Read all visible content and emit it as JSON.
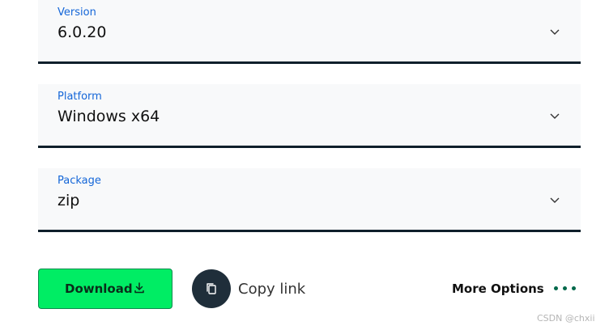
{
  "selects": [
    {
      "label": "Version",
      "value": "6.0.20",
      "icon": "chevron-down-icon"
    },
    {
      "label": "Platform",
      "value": "Windows x64",
      "icon": "chevron-down-icon"
    },
    {
      "label": "Package",
      "value": "zip",
      "icon": "chevron-down-icon"
    }
  ],
  "actions": {
    "download_label": "Download",
    "download_icon": "download-icon",
    "copy_link_label": "Copy link",
    "copy_icon": "copy-icon",
    "more_options_label": "More Options",
    "more_icon": "more-dots-icon"
  },
  "watermark": {
    "text": "CSDN @chxii"
  },
  "colors": {
    "label_blue": "#1466d8",
    "dropdown_bg": "#f8f9fa",
    "dropdown_border": "#0f1f2b",
    "download_green": "#00ed64",
    "download_border": "#0c8a4f",
    "copy_circle": "#1f2e3a",
    "dots_green": "#00684a"
  }
}
